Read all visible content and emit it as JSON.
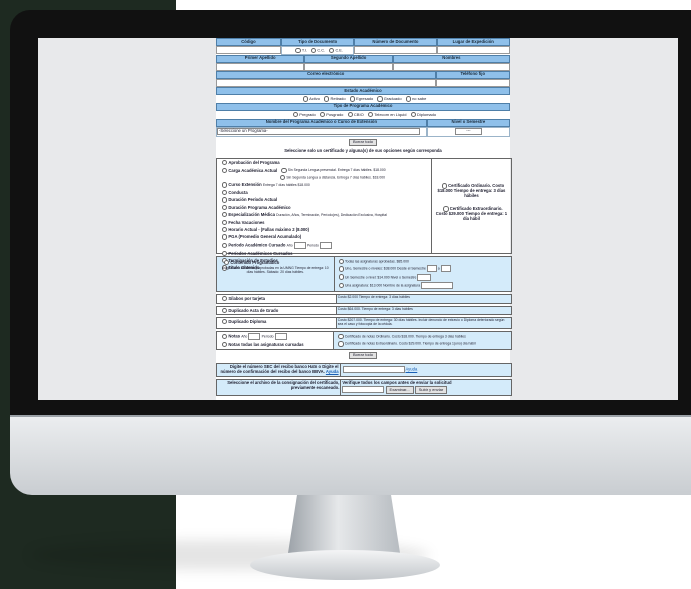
{
  "form": {
    "row1_headers": [
      "Código",
      "Tipo de Documento",
      "Número de Documento",
      "Lugar de Expedición"
    ],
    "doc_types": [
      "T.I.",
      "C.C.",
      "C.E."
    ],
    "row2_headers": [
      "Primer Apellido",
      "Segundo Apellido",
      "Nombres"
    ],
    "row3_headers": [
      "Correo electrónico",
      "Teléfono fijo"
    ],
    "estado_header": "Estado Académico",
    "estado_options": [
      "Activo",
      "Retirado",
      "Egresado",
      "Graduado",
      "no sabe"
    ],
    "tipo_header": "Tipo de Programa Académico",
    "tipo_options": [
      "Pregrado",
      "Posgrado",
      "CBIO",
      "Telecom en Liquid",
      "Diplomado"
    ],
    "programa_header": "Nombre del Programa Académico o Curso de Extensión",
    "nivel_header": "Nivel o Semestre",
    "programa_select": "-Seleccione un Programa-",
    "nivel_select": "---",
    "borrar_label": "Borrar todo",
    "instruction": "Seleccione solo un certificado y alguna(s) de sus opciones según corresponda",
    "cert_items": [
      "Aprobación del Programa",
      "Carga Académica Actual",
      "Curso Extensión",
      "Conducta",
      "Duración Período Actual",
      "Duración Programa Académico",
      "Especialización Médica",
      "Fecha Vacaciones",
      "Horario Actual - (Fallas máximo 2 (8.000)",
      "PGA (Promedio General Acumulado)",
      "Período Académico Cursado",
      "Períodos Académicos Cursados",
      "Terminación de Estudios",
      "Título Obtenido"
    ],
    "carga_options": [
      "Sin Segunda Lengua presencial. Entrega 7 días hábiles. $18.000",
      "Sin Segunda Lengua a distancia. Entrega 7 días hábiles. $18.000"
    ],
    "curso_note": "Entrega 7 días hábiles $18.000",
    "especializacion_note": "Duración, Años, Terminación, Período(es), Dedicación Exclusiva, Hospital",
    "periodo_label_ano": "Año",
    "periodo_label_periodo": "Período",
    "cert_ordinario": "Certificado Ordinario. Costo $18.000 Tiempo de entrega: 3 días hábiles",
    "cert_extra": "Certificado Extraordinario. Costo $29.000 Tiempo de entrega: 1 día hábil",
    "contenido_label": "Contenido Programático",
    "contenido_note": "Asignaturas cursadas y aprobadas en la UMNG Tiempo de entrega: 10 días hábiles. Sábado: 20 días hábiles.",
    "contenido_options": [
      "Todas las asignaturas aprobadas. $85.000",
      "Uno, Semestre o niveles: $38.000 Desde el Semestre",
      "Un Semestre o nivel: $14.000 Nivel o Semestre",
      "Una asignatura: $13.000 Nombre de la asignatura"
    ],
    "contenido_hasta": "a",
    "single_rows": [
      {
        "label": "Sílabos por tarjeta",
        "note": "Costo $2.000 Tiempo de entrega: 3 días hábiles"
      },
      {
        "label": "Duplicado Acta de Grado",
        "note": "Costo $64.000. Tiempo de entrega: 3 días hábiles"
      },
      {
        "label": "Duplicado Diploma",
        "note": "Costo $207.000. Tiempo de entrega: 30 días hábiles. Incluir denuncio de extravío o Diploma deteriorado según sea el caso y fotocopia de la cédula."
      }
    ],
    "notas_label": "Notas",
    "notas_ano": "Año",
    "notas_periodo": "Período",
    "notas_options": [
      "Certificado de notas Ordinario. Costo $18.000. Tiempo de entrega 3 días hábiles",
      "Certificado de notas Extraordinario. Costo $29.000. Tiempo de entrega 1(uno) día hábil"
    ],
    "todas_label": "Notas todas las asignaturas cursadas",
    "borrar_label2": "Borrar todo",
    "digite_label": "Digite el número SEC del recibo banco Hatn o Digite el número de confirmación del recibo del banco BBVA.",
    "ayuda_link": "Ayuda",
    "ayuda_link2": "Ayuda",
    "adjuntar_label": "Seleccione el archivo de la consignación del certificado, previamente escaneado.",
    "verifique_label": "Verifique todos los campos antes de enviar la solicitud",
    "examinar_label": "Examinar...",
    "subir_label": "Subir y enviar"
  }
}
